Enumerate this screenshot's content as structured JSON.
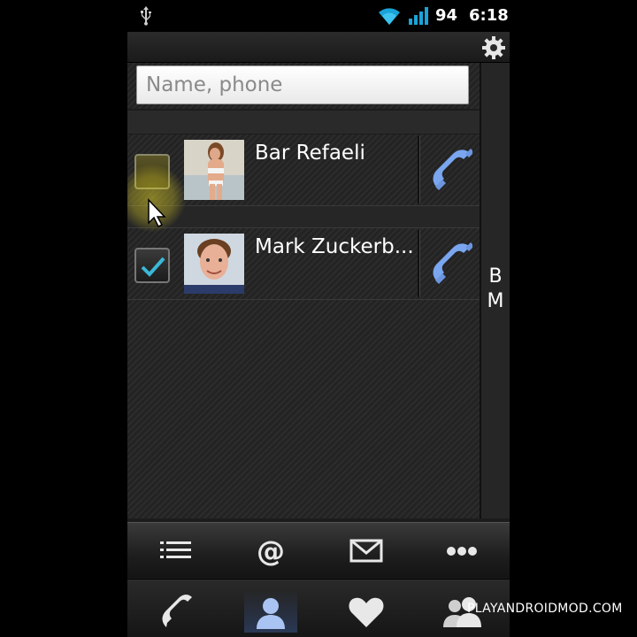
{
  "status_bar": {
    "battery": "94",
    "time": "6:18",
    "icons": [
      "usb-icon",
      "wifi-icon",
      "signal-icon"
    ]
  },
  "search": {
    "placeholder": "Name, phone",
    "value": ""
  },
  "contacts": [
    {
      "name": "Bar Refaeli",
      "checked": false
    },
    {
      "name": "Mark Zuckerb...",
      "checked": true
    }
  ],
  "index_letters": [
    "B",
    "M"
  ],
  "action_bar": [
    "list-icon",
    "at-icon",
    "envelope-icon",
    "more-icon"
  ],
  "nav_bar": [
    "phone-icon",
    "contacts-icon",
    "heart-icon",
    "groups-icon"
  ],
  "watermark": "PLAYANDROIDMOD.COM",
  "colors": {
    "accent_blue": "#7aa6f0",
    "check_teal": "#3ab8d8",
    "highlight": "#d7c828"
  }
}
